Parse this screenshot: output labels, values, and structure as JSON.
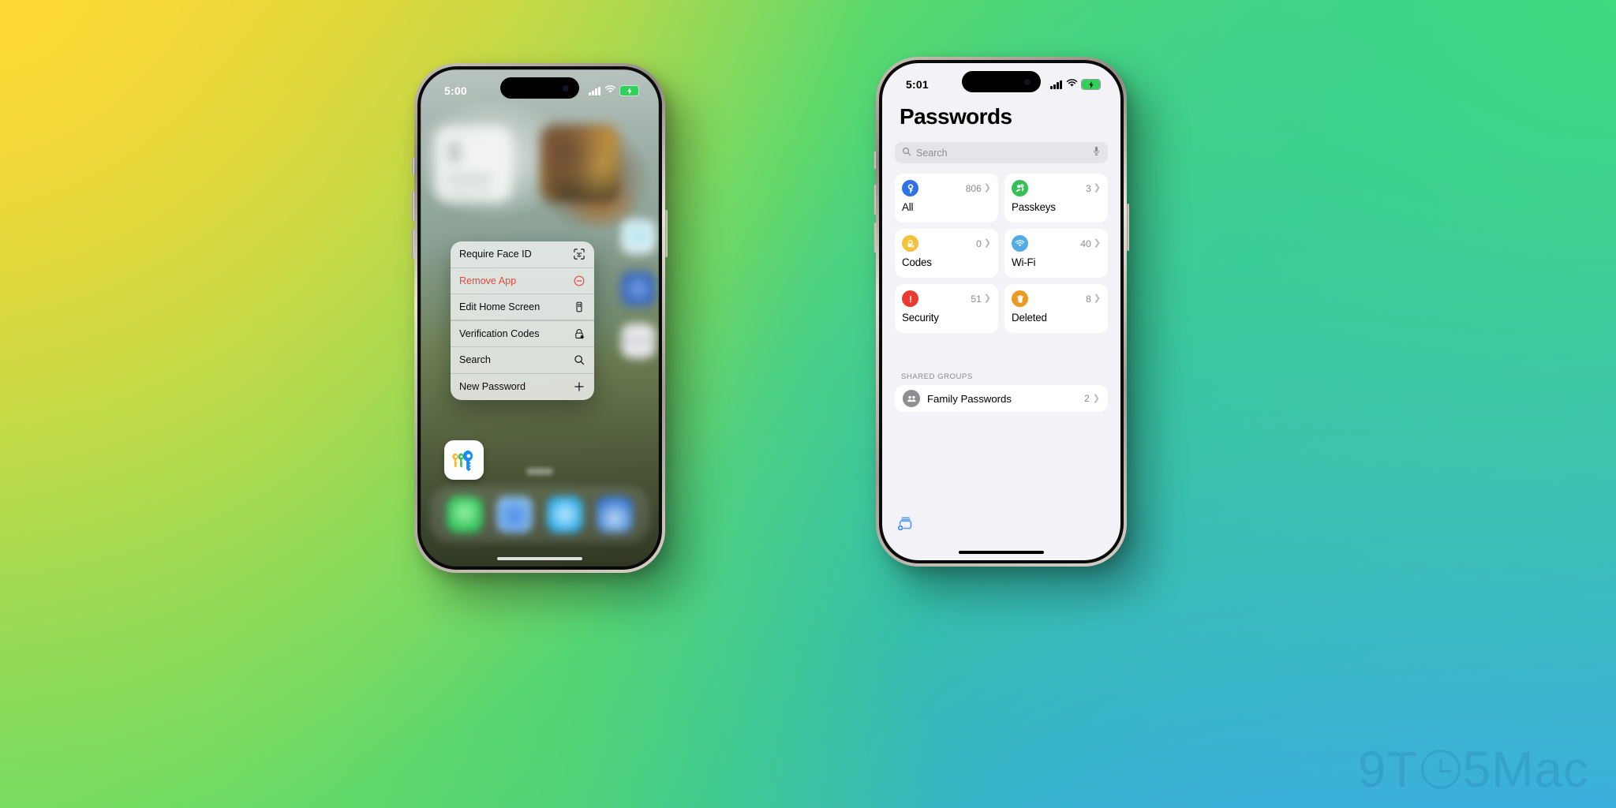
{
  "background": {
    "gradient_colors": [
      "#f9d92e",
      "#5fd96a",
      "#32c98f",
      "#3ba6f2"
    ]
  },
  "watermark": {
    "text_before": "9T",
    "text_after": "5Mac"
  },
  "left_phone": {
    "status_bar": {
      "time": "5:00",
      "signal": "cellular-bars-icon",
      "wifi": "wifi-icon",
      "battery": "battery-charging-icon"
    },
    "home_screen": {
      "app_icon_label": "passwords-app-icon",
      "dock_icons": [
        "messages",
        "safari",
        "mail",
        "app-store"
      ]
    },
    "context_menu": {
      "items": [
        {
          "label": "Require Face ID",
          "icon": "face-id-icon",
          "destructive": false
        },
        {
          "label": "Remove App",
          "icon": "minus-circle-icon",
          "destructive": true
        },
        {
          "label": "Edit Home Screen",
          "icon": "edit-home-screen-icon",
          "destructive": false
        },
        {
          "label": "Verification Codes",
          "icon": "lock-badge-icon",
          "destructive": false
        },
        {
          "label": "Search",
          "icon": "search-icon",
          "destructive": false
        },
        {
          "label": "New Password",
          "icon": "plus-icon",
          "destructive": false
        }
      ]
    }
  },
  "right_phone": {
    "status_bar": {
      "time": "5:01",
      "signal": "cellular-bars-icon",
      "wifi": "wifi-icon",
      "battery": "battery-charging-icon"
    },
    "app": {
      "title": "Passwords",
      "search": {
        "placeholder": "Search",
        "icon": "search-icon",
        "mic_icon": "microphone-icon"
      },
      "categories": [
        {
          "label": "All",
          "count": "806",
          "icon": "key-icon",
          "color": "#2f72e8"
        },
        {
          "label": "Passkeys",
          "count": "3",
          "icon": "passkey-icon",
          "color": "#34c056"
        },
        {
          "label": "Codes",
          "count": "0",
          "icon": "code-lock-icon",
          "color": "#f5c13a"
        },
        {
          "label": "Wi-Fi",
          "count": "40",
          "icon": "wifi-icon",
          "color": "#51ace4"
        },
        {
          "label": "Security",
          "count": "51",
          "icon": "warning-icon",
          "color": "#ec3b2e"
        },
        {
          "label": "Deleted",
          "count": "8",
          "icon": "trash-icon",
          "color": "#eb9a24"
        }
      ],
      "shared_groups": {
        "header": "SHARED GROUPS",
        "rows": [
          {
            "label": "Family Passwords",
            "count": "2",
            "icon": "people-group-icon"
          }
        ]
      },
      "toolbar": {
        "new_group_icon": "new-shared-group-icon"
      }
    }
  }
}
